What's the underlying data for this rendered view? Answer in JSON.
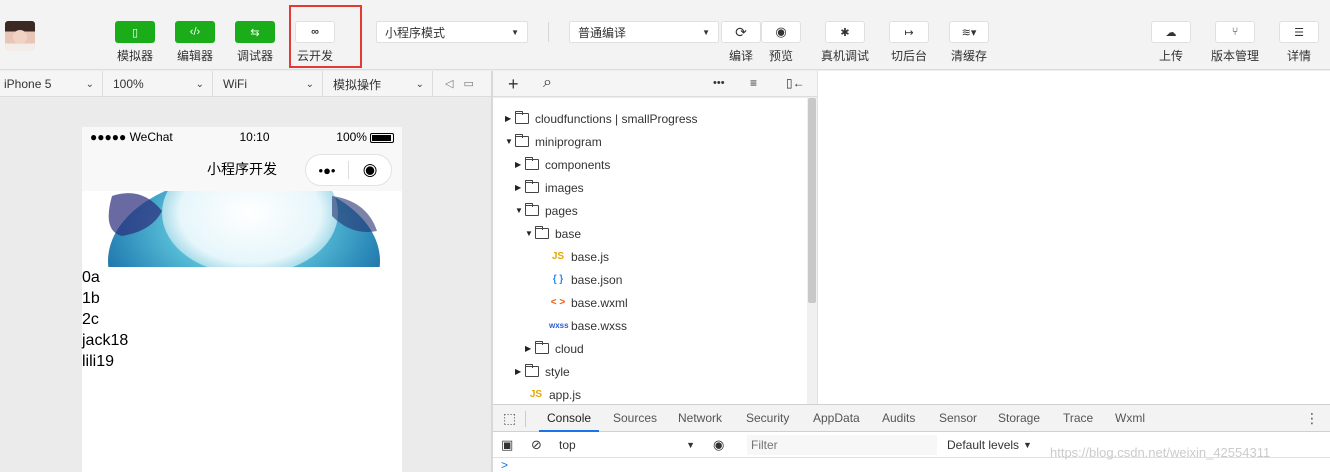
{
  "toolbar": {
    "buttons": [
      {
        "label": "模拟器",
        "icon": "phone-icon"
      },
      {
        "label": "编辑器",
        "icon": "code-icon"
      },
      {
        "label": "调试器",
        "icon": "debug-arrows-icon"
      },
      {
        "label": "云开发",
        "icon": "cloud-link-icon"
      },
      {
        "label": "编译",
        "icon": "refresh-icon"
      },
      {
        "label": "预览",
        "icon": "eye-icon"
      },
      {
        "label": "真机调试",
        "icon": "bug-icon"
      },
      {
        "label": "切后台",
        "icon": "switch-background-icon"
      },
      {
        "label": "清缓存",
        "icon": "layers-icon"
      },
      {
        "label": "上传",
        "icon": "cloud-upload-icon"
      },
      {
        "label": "版本管理",
        "icon": "branch-icon"
      },
      {
        "label": "详情",
        "icon": "menu-icon"
      }
    ],
    "mode_select": "小程序模式",
    "compile_select": "普通编译"
  },
  "simulator_bar": {
    "device": "iPhone 5",
    "zoom": "100%",
    "network": "WiFi",
    "operation": "模拟操作"
  },
  "phone": {
    "carrier": "●●●●● WeChat",
    "time": "10:10",
    "battery": "100%",
    "nav_title": "小程序开发",
    "capsule_more": "•●•",
    "capsule_close": "◉",
    "list": [
      "0a",
      "1b",
      "2c",
      "jack18",
      "lili19"
    ]
  },
  "explorer": {
    "add": "+",
    "search": "⌕",
    "more": "•••",
    "tree": [
      {
        "label": "cloudfunctions | smallProgress",
        "type": "cloud-folder",
        "depth": 0,
        "expanded": false
      },
      {
        "label": "miniprogram",
        "type": "folder",
        "depth": 0,
        "expanded": true
      },
      {
        "label": "components",
        "type": "folder",
        "depth": 1,
        "expanded": false
      },
      {
        "label": "images",
        "type": "folder",
        "depth": 1,
        "expanded": false
      },
      {
        "label": "pages",
        "type": "folder",
        "depth": 1,
        "expanded": true
      },
      {
        "label": "base",
        "type": "folder",
        "depth": 2,
        "expanded": true
      },
      {
        "label": "base.js",
        "type": "js",
        "depth": 3
      },
      {
        "label": "base.json",
        "type": "json",
        "depth": 3
      },
      {
        "label": "base.wxml",
        "type": "wxml",
        "depth": 3
      },
      {
        "label": "base.wxss",
        "type": "wxss",
        "depth": 3
      },
      {
        "label": "cloud",
        "type": "folder",
        "depth": 2,
        "expanded": false
      },
      {
        "label": "style",
        "type": "folder",
        "depth": 1,
        "expanded": false
      },
      {
        "label": "app.js",
        "type": "js",
        "depth": 1
      }
    ],
    "file_tags": {
      "js": "JS",
      "json": "{ }",
      "wxml": "< >",
      "wxss": "wxss"
    }
  },
  "devtools": {
    "tabs": [
      "Console",
      "Sources",
      "Network",
      "Security",
      "AppData",
      "Audits",
      "Sensor",
      "Storage",
      "Trace",
      "Wxml"
    ],
    "active_tab": "Console",
    "context": "top",
    "filter_placeholder": "Filter",
    "levels": "Default levels",
    "prompt": ">"
  },
  "watermark": "https://blog.csdn.net/weixin_42554311",
  "colors": {
    "accent_green": "#1aad19",
    "highlight_red": "#e53935",
    "tab_blue": "#1a73e8"
  }
}
